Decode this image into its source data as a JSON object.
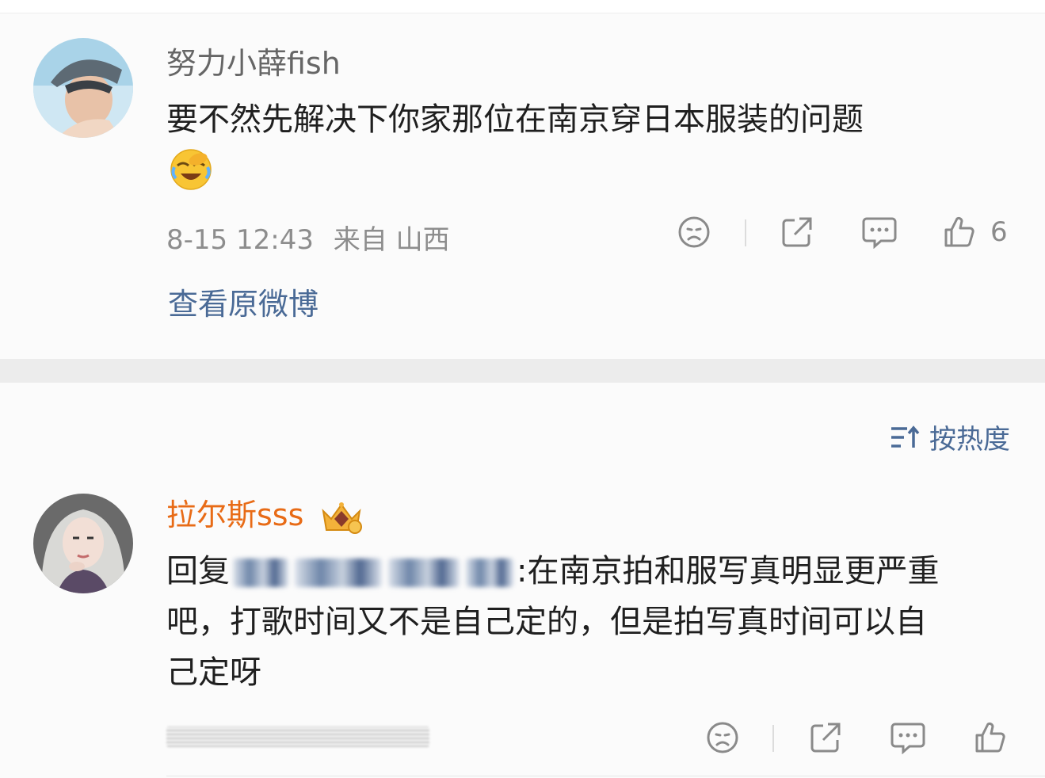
{
  "comment1": {
    "username": "努力小薛fish",
    "text": "要不然先解决下你家那位在南京穿日本服装的问题",
    "emoji": "laughing-crying-emoji",
    "timestamp": "8-15 12:43",
    "location": "来自 山西",
    "like_count": "6",
    "view_original_label": "查看原微博",
    "colors": {
      "username": "#666666",
      "link": "#4a6a96"
    }
  },
  "sort": {
    "label": "按热度",
    "icon": "sort-icon"
  },
  "comment2": {
    "username": "拉尔斯sss",
    "badge": "crown-badge-icon",
    "reply_prefix": "回复",
    "reply_suffix": ":在南京拍和服写真明显更严重",
    "text_line2": "吧，打歌时间又不是自己定的，但是拍写真时间可以自",
    "text_line3": "己定呀",
    "colors": {
      "username": "#e86b16"
    }
  },
  "icons": {
    "dislike": "sad-face-icon",
    "share": "share-icon",
    "comment": "comment-icon",
    "like": "thumbs-up-icon"
  }
}
